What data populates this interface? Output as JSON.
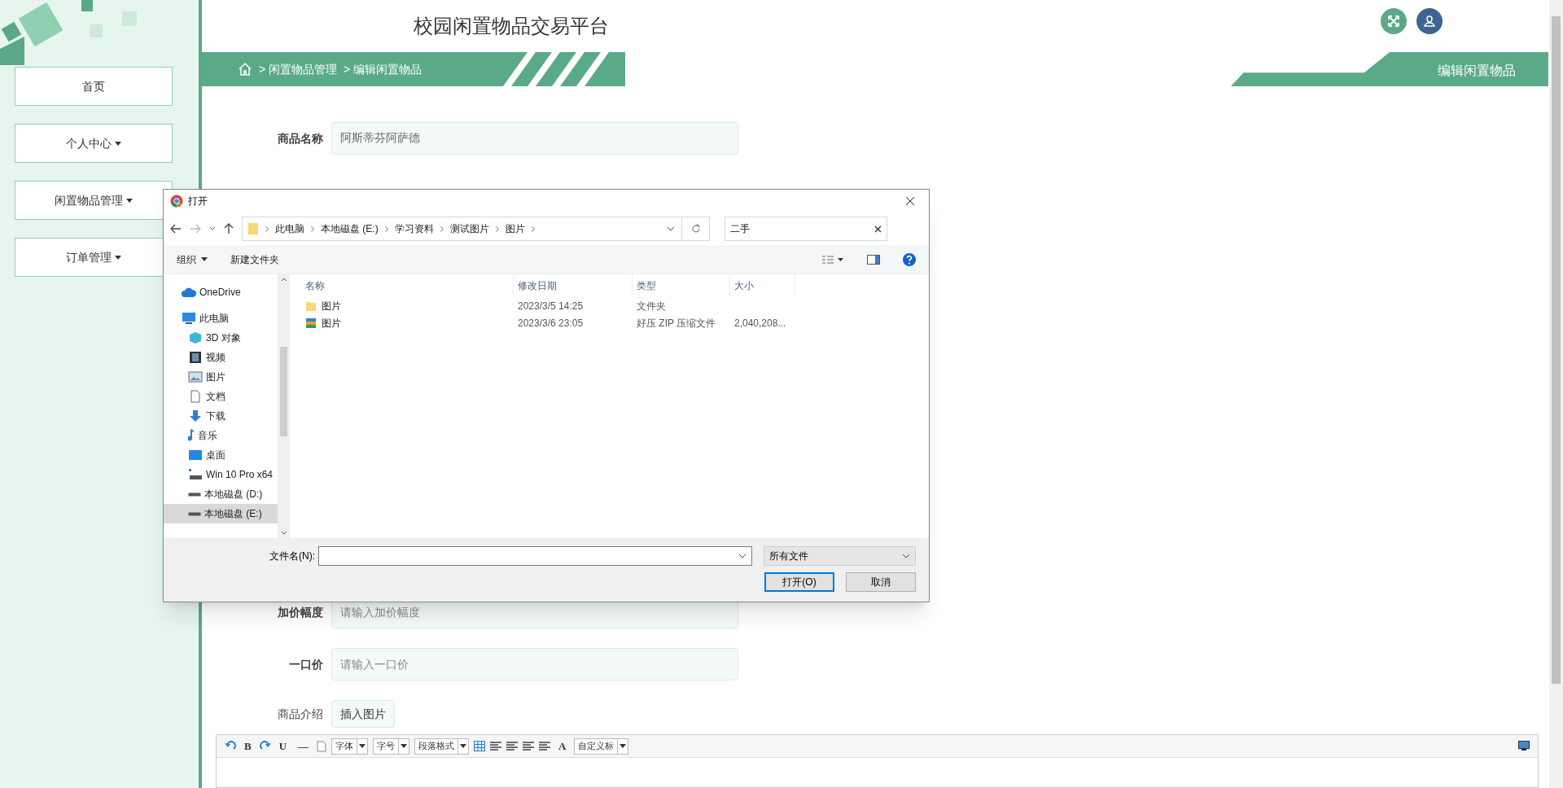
{
  "sidebar": {
    "items": [
      {
        "label": "首页",
        "dropdown": false
      },
      {
        "label": "个人中心",
        "dropdown": true
      },
      {
        "label": "闲置物品管理",
        "dropdown": true
      },
      {
        "label": "订单管理",
        "dropdown": true
      }
    ]
  },
  "header": {
    "title": "校园闲置物品交易平台"
  },
  "breadcrumb": [
    "> 闲置物品管理",
    "> 编辑闲置物品"
  ],
  "page_tab": "编辑闲置物品",
  "form": {
    "name": {
      "label": "商品名称",
      "value": "阿斯蒂芬阿萨德"
    },
    "fields": [
      {
        "label": "加价幅度",
        "placeholder": "请输入加价幅度"
      },
      {
        "label": "一口价",
        "placeholder": "请输入一口价"
      }
    ],
    "intro": {
      "label": "商品介绍",
      "button": "插入图片"
    }
  },
  "editor": {
    "toolbar": [
      {
        "kind": "undo"
      },
      {
        "kind": "char",
        "text": "B"
      },
      {
        "kind": "redo"
      },
      {
        "kind": "char",
        "text": "U"
      },
      {
        "kind": "char",
        "text": "—"
      },
      {
        "kind": "doc"
      },
      {
        "kind": "select",
        "text": "字体"
      },
      {
        "kind": "select",
        "text": "字号"
      },
      {
        "kind": "select",
        "text": "段落格式"
      },
      {
        "kind": "table"
      },
      {
        "kind": "align"
      },
      {
        "kind": "align"
      },
      {
        "kind": "align"
      },
      {
        "kind": "align"
      },
      {
        "kind": "char",
        "text": "A"
      },
      {
        "kind": "select",
        "text": "自定义标"
      }
    ]
  },
  "dialog": {
    "title": "打开",
    "path": [
      "此电脑",
      "本地磁盘 (E:)",
      "学习资料",
      "测试图片",
      "图片"
    ],
    "search": {
      "value": "二手"
    },
    "toolbar": {
      "organize": "组织",
      "new_folder": "新建文件夹"
    },
    "nav": [
      {
        "label": "OneDrive",
        "kind": "cloud",
        "selected": false
      },
      {
        "label": "此电脑",
        "kind": "pc",
        "selected": false,
        "children": [
          {
            "label": "3D 对象",
            "kind": "cube",
            "selected": false
          },
          {
            "label": "视频",
            "kind": "video",
            "selected": false
          },
          {
            "label": "图片",
            "kind": "image",
            "selected": false
          },
          {
            "label": "文档",
            "kind": "doc",
            "selected": false
          },
          {
            "label": "下载",
            "kind": "download",
            "selected": false
          },
          {
            "label": "音乐",
            "kind": "music",
            "selected": false
          },
          {
            "label": "桌面",
            "kind": "desktop",
            "selected": false
          },
          {
            "label": "Win 10 Pro x64",
            "kind": "netdrive",
            "selected": false
          },
          {
            "label": "本地磁盘 (D:)",
            "kind": "drive",
            "selected": false
          },
          {
            "label": "本地磁盘 (E:)",
            "kind": "drive",
            "selected": true
          }
        ]
      }
    ],
    "columns": [
      "名称",
      "修改日期",
      "类型",
      "大小"
    ],
    "files": [
      {
        "name": "图片",
        "kind": "folder",
        "date": "2023/3/5 14:25",
        "type": "文件夹"
      },
      {
        "name": "图片",
        "kind": "zip",
        "date": "2023/3/6 23:05",
        "type": "好压 ZIP 压缩文件",
        "size": "2,040,208..."
      }
    ],
    "filename_label": "文件名(N):",
    "filetype": "所有文件",
    "buttons": [
      "打开(O)",
      "取消"
    ]
  }
}
